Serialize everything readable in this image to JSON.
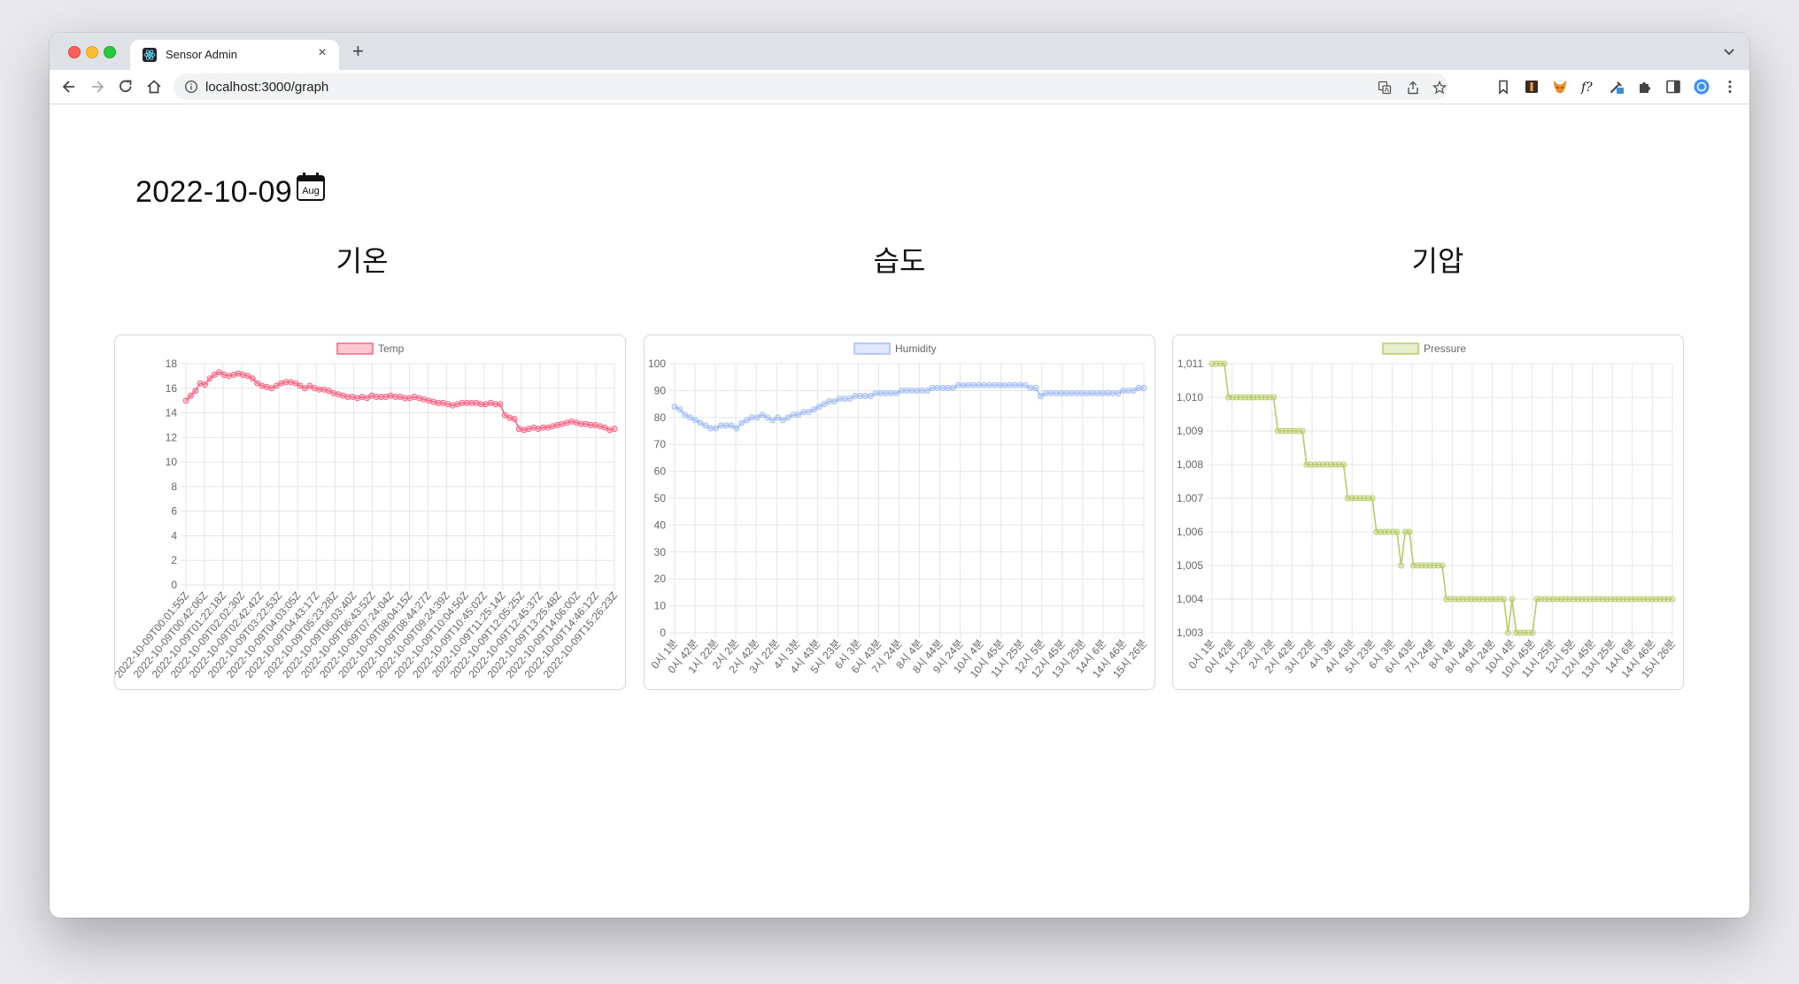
{
  "browser": {
    "tab_title": "Sensor Admin",
    "tab_close": "×",
    "new_tab": "+",
    "url": "localhost:3000/graph"
  },
  "page": {
    "date": "2022-10-09",
    "calendar_icon_text": "Aug"
  },
  "charts": [
    {
      "title": "기온"
    },
    {
      "title": "습도"
    },
    {
      "title": "기압"
    }
  ],
  "chart_data": [
    {
      "type": "line",
      "title": "기온",
      "series": [
        {
          "name": "Temp",
          "color": "#ff6384",
          "values": [
            15.0,
            15.4,
            15.8,
            16.4,
            16.3,
            16.8,
            17.1,
            17.3,
            17.1,
            17.0,
            17.1,
            17.2,
            17.1,
            17.0,
            16.8,
            16.4,
            16.2,
            16.1,
            16.0,
            16.2,
            16.4,
            16.5,
            16.5,
            16.4,
            16.2,
            16.0,
            16.2,
            16.0,
            15.9,
            15.9,
            15.8,
            15.6,
            15.5,
            15.4,
            15.3,
            15.3,
            15.2,
            15.3,
            15.2,
            15.4,
            15.3,
            15.3,
            15.3,
            15.4,
            15.3,
            15.3,
            15.2,
            15.2,
            15.3,
            15.2,
            15.1,
            15.0,
            14.9,
            14.8,
            14.8,
            14.7,
            14.6,
            14.7,
            14.8,
            14.8,
            14.8,
            14.8,
            14.7,
            14.7,
            14.8,
            14.7,
            14.7,
            13.8,
            13.6,
            13.5,
            12.7,
            12.6,
            12.7,
            12.8,
            12.7,
            12.8,
            12.8,
            12.9,
            13.0,
            13.1,
            13.2,
            13.3,
            13.2,
            13.1,
            13.1,
            13.0,
            13.0,
            12.9,
            12.8,
            12.6,
            12.7
          ]
        }
      ],
      "x_tick_labels": [
        "2022-10-09T00:01:55Z",
        "2022-10-09T00:42:06Z",
        "2022-10-09T01:22:18Z",
        "2022-10-09T02:02:30Z",
        "2022-10-09T02:42:42Z",
        "2022-10-09T03:22:53Z",
        "2022-10-09T04:03:05Z",
        "2022-10-09T04:43:17Z",
        "2022-10-09T05:23:28Z",
        "2022-10-09T06:03:40Z",
        "2022-10-09T06:43:52Z",
        "2022-10-09T07:24:04Z",
        "2022-10-09T08:04:15Z",
        "2022-10-09T08:44:27Z",
        "2022-10-09T09:24:39Z",
        "2022-10-09T10:04:50Z",
        "2022-10-09T10:45:02Z",
        "2022-10-09T11:25:14Z",
        "2022-10-09T12:05:25Z",
        "2022-10-09T12:45:37Z",
        "2022-10-09T13:25:48Z",
        "2022-10-09T14:06:00Z",
        "2022-10-09T14:46:12Z",
        "2022-10-09T15:26:23Z"
      ],
      "y_ticks": [
        "0",
        "2",
        "4",
        "6",
        "8",
        "10",
        "12",
        "14",
        "16",
        "18"
      ],
      "ylim": [
        0,
        18
      ],
      "grid": true,
      "legend_position": "top"
    },
    {
      "type": "line",
      "title": "습도",
      "series": [
        {
          "name": "Humidity",
          "color": "#a3bdf5",
          "values": [
            84,
            83,
            81,
            80,
            79,
            78,
            77,
            76,
            76,
            77,
            77,
            77,
            76,
            78,
            79,
            80,
            80,
            81,
            80,
            79,
            80,
            79,
            80,
            81,
            81,
            82,
            82,
            83,
            84,
            85,
            86,
            86,
            87,
            87,
            87,
            88,
            88,
            88,
            88,
            89,
            89,
            89,
            89,
            89,
            90,
            90,
            90,
            90,
            90,
            90,
            91,
            91,
            91,
            91,
            91,
            92,
            92,
            92,
            92,
            92,
            92,
            92,
            92,
            92,
            92,
            92,
            92,
            92,
            92,
            91,
            91,
            88,
            89,
            89,
            89,
            89,
            89,
            89,
            89,
            89,
            89,
            89,
            89,
            89,
            89,
            89,
            89,
            90,
            90,
            90,
            91,
            91
          ]
        }
      ],
      "x_tick_labels": [
        "0시 1분",
        "0시 42분",
        "1시 22분",
        "2시 2분",
        "2시 42분",
        "3시 22분",
        "4시 3분",
        "4시 43분",
        "5시 23분",
        "6시 3분",
        "6시 43분",
        "7시 24분",
        "8시 4분",
        "8시 44분",
        "9시 24분",
        "10시 4분",
        "10시 45분",
        "11시 25분",
        "12시 5분",
        "12시 45분",
        "13시 25분",
        "14시 6분",
        "14시 46분",
        "15시 26분"
      ],
      "y_ticks": [
        "0",
        "10",
        "20",
        "30",
        "40",
        "50",
        "60",
        "70",
        "80",
        "90",
        "100"
      ],
      "ylim": [
        0,
        100
      ],
      "grid": true,
      "legend_position": "top"
    },
    {
      "type": "line",
      "title": "기압",
      "series": [
        {
          "name": "Pressure",
          "color": "#b7cc6a",
          "values": [
            1011,
            1011,
            1011,
            1011,
            1010,
            1010,
            1010,
            1010,
            1010,
            1010,
            1010,
            1010,
            1010,
            1010,
            1010,
            1010,
            1009,
            1009,
            1009,
            1009,
            1009,
            1009,
            1009,
            1008,
            1008,
            1008,
            1008,
            1008,
            1008,
            1008,
            1008,
            1008,
            1008,
            1007,
            1007,
            1007,
            1007,
            1007,
            1007,
            1007,
            1006,
            1006,
            1006,
            1006,
            1006,
            1006,
            1005,
            1006,
            1006,
            1005,
            1005,
            1005,
            1005,
            1005,
            1005,
            1005,
            1005,
            1004,
            1004,
            1004,
            1004,
            1004,
            1004,
            1004,
            1004,
            1004,
            1004,
            1004,
            1004,
            1004,
            1004,
            1004,
            1003,
            1004,
            1003,
            1003,
            1003,
            1003,
            1003,
            1004,
            1004,
            1004,
            1004,
            1004,
            1004,
            1004,
            1004,
            1004,
            1004,
            1004,
            1004,
            1004,
            1004,
            1004,
            1004,
            1004,
            1004,
            1004,
            1004,
            1004,
            1004,
            1004,
            1004,
            1004,
            1004,
            1004,
            1004,
            1004,
            1004,
            1004,
            1004,
            1004,
            1004
          ]
        }
      ],
      "x_tick_labels": [
        "0시 1분",
        "0시 42분",
        "1시 22분",
        "2시 2분",
        "2시 42분",
        "3시 22분",
        "4시 3분",
        "4시 43분",
        "5시 23분",
        "6시 3분",
        "6시 43분",
        "7시 24분",
        "8시 4분",
        "8시 44분",
        "9시 24분",
        "10시 4분",
        "10시 45분",
        "11시 25분",
        "12시 5분",
        "12시 45분",
        "13시 25분",
        "14시 6분",
        "14시 46분",
        "15시 26분"
      ],
      "y_ticks": [
        "1,003",
        "1,004",
        "1,005",
        "1,006",
        "1,007",
        "1,008",
        "1,009",
        "1,010",
        "1,011"
      ],
      "ylim": [
        1003,
        1011
      ],
      "grid": true,
      "legend_position": "top"
    }
  ]
}
